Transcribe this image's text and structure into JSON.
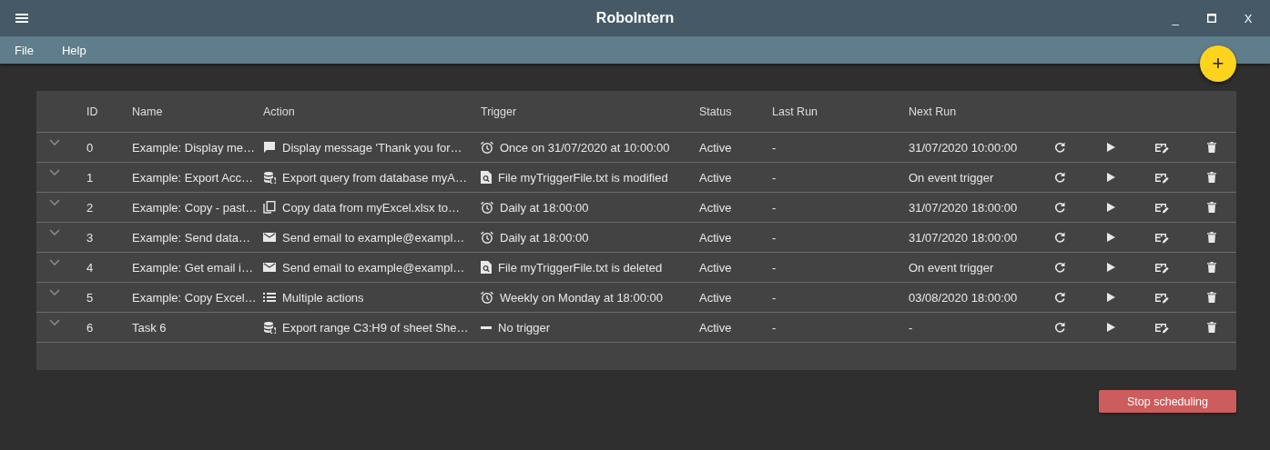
{
  "window": {
    "title": "RoboIntern",
    "controls": [
      "_",
      "X"
    ]
  },
  "menu": [
    "File",
    "Help"
  ],
  "add_button": {
    "label": "+"
  },
  "table": {
    "columns": [
      "ID",
      "Name",
      "Action",
      "Trigger",
      "Status",
      "Last Run",
      "Next Run"
    ],
    "rows": [
      {
        "id": "0",
        "name": "Example: Display me…",
        "action": {
          "kind": "message",
          "text": "Display message 'Thank you for…"
        },
        "trigger": {
          "kind": "clock",
          "text": "Once on 31/07/2020 at 10:00:00"
        },
        "status": "Active",
        "last_run": "-",
        "next_run": "31/07/2020 10:00:00"
      },
      {
        "id": "1",
        "name": "Example: Export Acc…",
        "action": {
          "kind": "database",
          "text": "Export query from database myA…"
        },
        "trigger": {
          "kind": "file",
          "text": "File myTriggerFile.txt is modified"
        },
        "status": "Active",
        "last_run": "-",
        "next_run": "On event trigger"
      },
      {
        "id": "2",
        "name": "Example: Copy - past…",
        "action": {
          "kind": "copy",
          "text": "Copy data from myExcel.xlsx to…"
        },
        "trigger": {
          "kind": "clock",
          "text": "Daily at 18:00:00"
        },
        "status": "Active",
        "last_run": "-",
        "next_run": "31/07/2020 18:00:00"
      },
      {
        "id": "3",
        "name": "Example: Send data…",
        "action": {
          "kind": "email",
          "text": "Send email to example@exampl…"
        },
        "trigger": {
          "kind": "clock",
          "text": "Daily at 18:00:00"
        },
        "status": "Active",
        "last_run": "-",
        "next_run": "31/07/2020 18:00:00"
      },
      {
        "id": "4",
        "name": "Example: Get email i…",
        "action": {
          "kind": "email",
          "text": "Send email to example@exampl…"
        },
        "trigger": {
          "kind": "file",
          "text": "File myTriggerFile.txt is deleted"
        },
        "status": "Active",
        "last_run": "-",
        "next_run": "On event trigger"
      },
      {
        "id": "5",
        "name": "Example: Copy Excel…",
        "action": {
          "kind": "list",
          "text": "Multiple actions"
        },
        "trigger": {
          "kind": "clock",
          "text": "Weekly on Monday at 18:00:00"
        },
        "status": "Active",
        "last_run": "-",
        "next_run": "03/08/2020 18:00:00"
      },
      {
        "id": "6",
        "name": "Task 6",
        "action": {
          "kind": "database",
          "text": "Export range C3:H9 of sheet She…"
        },
        "trigger": {
          "kind": "none",
          "text": "No trigger"
        },
        "status": "Active",
        "last_run": "-",
        "next_run": "-"
      }
    ]
  },
  "stop_button": {
    "label": "Stop scheduling"
  }
}
